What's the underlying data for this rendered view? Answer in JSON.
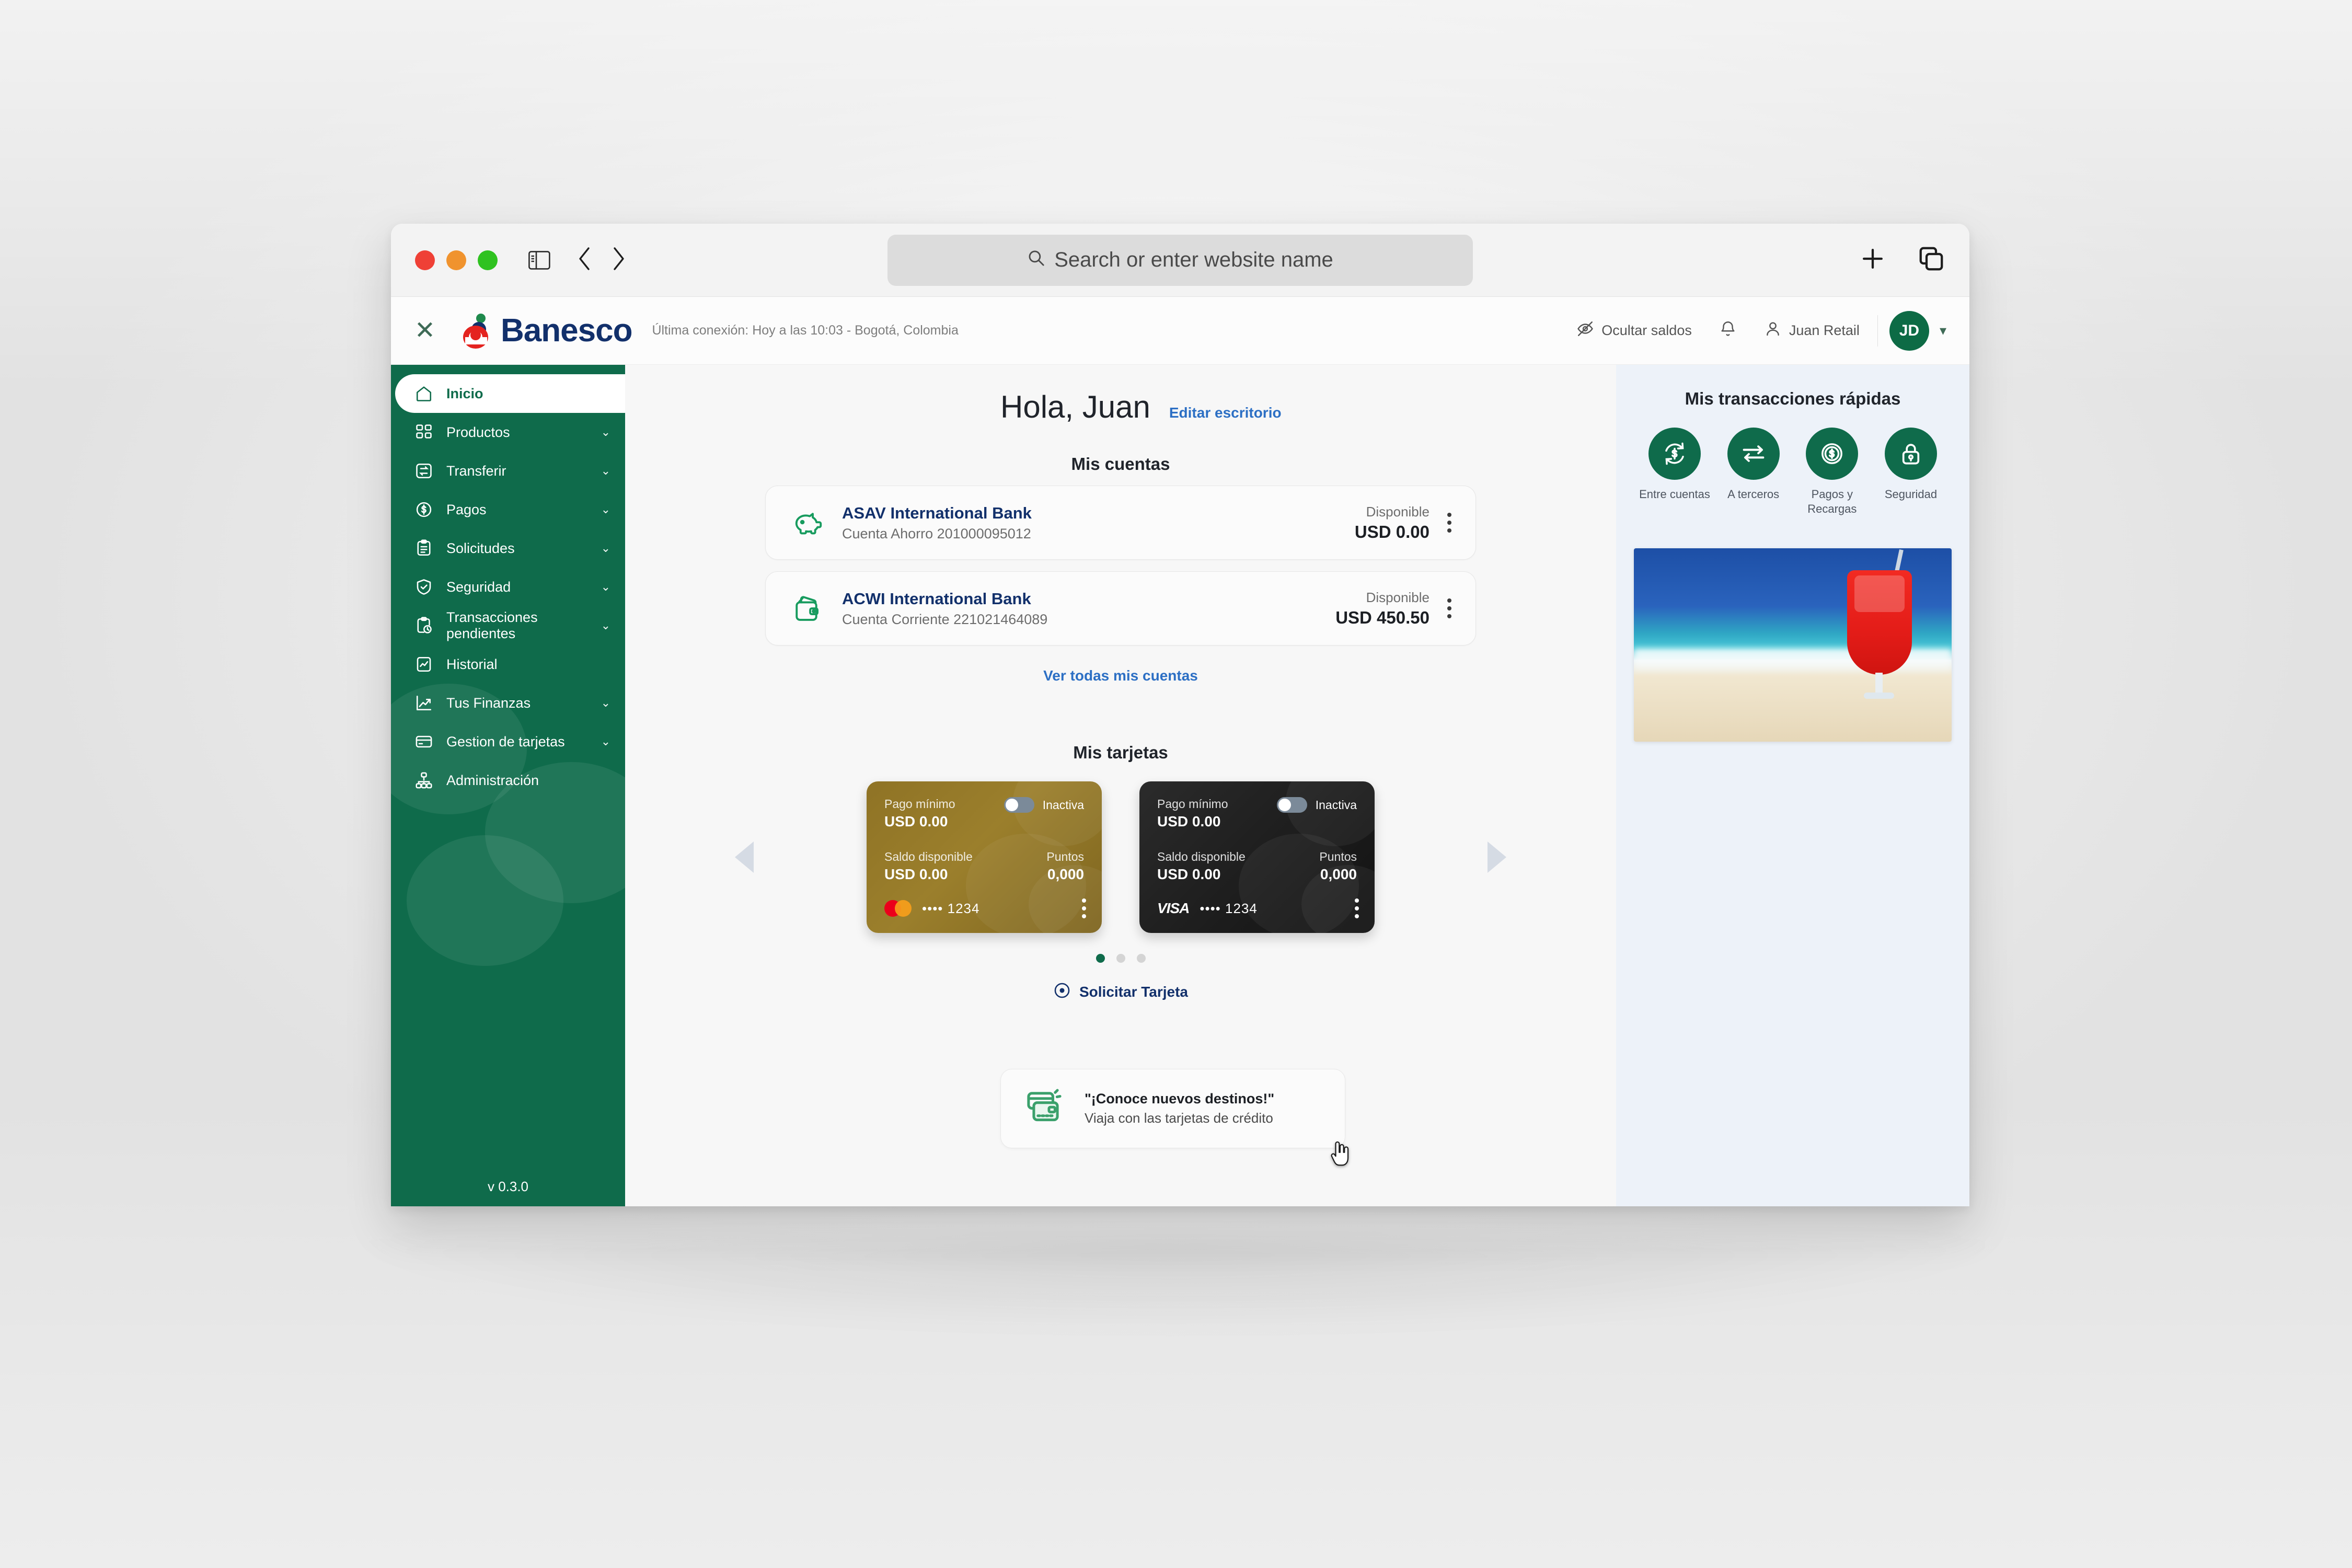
{
  "browser": {
    "omnibox_placeholder": "Search or enter website name",
    "icons": {
      "sidebar_toggle": "sidebar-toggle-icon",
      "back": "back-chevron-icon",
      "forward": "forward-chevron-icon",
      "search": "search-icon",
      "new_tab": "plus-icon",
      "tab_overview": "tab-overview-icon"
    }
  },
  "appbar": {
    "close_label": "✕",
    "brand": "Banesco",
    "last_connection": "Última conexión: Hoy a las 10:03 - Bogotá, Colombia",
    "hide_balances": "Ocultar saldos",
    "user_name": "Juan Retail",
    "avatar_initials": "JD",
    "caret": "▾"
  },
  "sidebar": {
    "version": "v 0.3.0",
    "items": [
      {
        "label": "Inicio",
        "icon": "home-icon",
        "active": true,
        "expandable": false
      },
      {
        "label": "Productos",
        "icon": "grid-icon",
        "active": false,
        "expandable": true
      },
      {
        "label": "Transferir",
        "icon": "transfer-icon",
        "active": false,
        "expandable": true
      },
      {
        "label": "Pagos",
        "icon": "dollar-circle-icon",
        "active": false,
        "expandable": true
      },
      {
        "label": "Solicitudes",
        "icon": "clipboard-list-icon",
        "active": false,
        "expandable": true
      },
      {
        "label": "Seguridad",
        "icon": "shield-check-icon",
        "active": false,
        "expandable": true
      },
      {
        "label": "Transacciones pendientes",
        "icon": "clipboard-clock-icon",
        "active": false,
        "expandable": true
      },
      {
        "label": "Historial",
        "icon": "history-icon",
        "active": false,
        "expandable": false
      },
      {
        "label": "Tus Finanzas",
        "icon": "trending-up-icon",
        "active": false,
        "expandable": true
      },
      {
        "label": "Gestion de tarjetas",
        "icon": "credit-card-icon",
        "active": false,
        "expandable": true
      },
      {
        "label": "Administración",
        "icon": "org-chart-icon",
        "active": false,
        "expandable": false
      }
    ]
  },
  "main": {
    "greeting": "Hola, Juan",
    "edit_desktop": "Editar escritorio",
    "accounts_title": "Mis cuentas",
    "accounts": [
      {
        "name": "ASAV International Bank",
        "subtitle": "Cuenta Ahorro 201000095012",
        "balance_label": "Disponible",
        "balance": "USD 0.00",
        "icon": "piggy-bank-icon"
      },
      {
        "name": "ACWI International Bank",
        "subtitle": "Cuenta Corriente 221021464089",
        "balance_label": "Disponible",
        "balance": "USD 450.50",
        "icon": "wallet-money-icon"
      }
    ],
    "see_all_accounts": "Ver todas mis cuentas",
    "cards_title": "Mis tarjetas",
    "cards": [
      {
        "theme": "gold",
        "min_payment_label": "Pago mínimo",
        "min_payment_value": "USD 0.00",
        "status_label": "Inactiva",
        "balance_label": "Saldo disponible",
        "balance_value": "USD 0.00",
        "points_label": "Puntos",
        "points_value": "0,000",
        "network": "mastercard",
        "network_label": "",
        "masked_number": "•••• 1234"
      },
      {
        "theme": "dark",
        "min_payment_label": "Pago mínimo",
        "min_payment_value": "USD 0.00",
        "status_label": "Inactiva",
        "balance_label": "Saldo disponible",
        "balance_value": "USD 0.00",
        "points_label": "Puntos",
        "points_value": "0,000",
        "network": "visa",
        "network_label": "VISA",
        "masked_number": "•••• 1234"
      }
    ],
    "carousel_dots": 3,
    "carousel_active_dot": 0,
    "request_card": "Solicitar Tarjeta",
    "promo": {
      "line1": "\"¡Conoce nuevos destinos!\"",
      "line2": "Viaja con las tarjetas de crédito",
      "icon": "credit-cards-icon"
    }
  },
  "rail": {
    "title": "Mis transacciones rápidas",
    "actions": [
      {
        "label": "Entre cuentas",
        "icon": "refresh-dollar-icon"
      },
      {
        "label": "A terceros",
        "icon": "exchange-arrows-icon"
      },
      {
        "label": "Pagos y Recargas",
        "icon": "dollar-circle-icon"
      },
      {
        "label": "Seguridad",
        "icon": "lock-icon"
      }
    ],
    "banner_alt": "beach-cocktail-image"
  },
  "colors": {
    "brand_green": "#0f6b4b",
    "brand_navy": "#12306b",
    "link_blue": "#2c6fc4",
    "rail_bg": "#edf2f9"
  }
}
